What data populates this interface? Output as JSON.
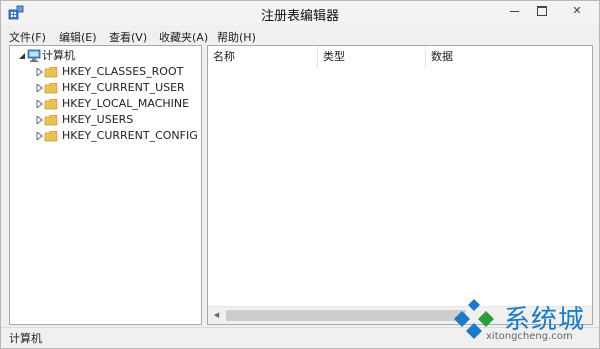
{
  "window": {
    "title": "注册表编辑器",
    "controls": {
      "close_glyph": "✕"
    }
  },
  "menu": {
    "items": [
      "文件(F)",
      "编辑(E)",
      "查看(V)",
      "收藏夹(A)",
      "帮助(H)"
    ]
  },
  "tree": {
    "root": {
      "label": "计算机",
      "icon": "computer-icon"
    },
    "items": [
      {
        "label": "HKEY_CLASSES_ROOT",
        "icon": "folder-icon"
      },
      {
        "label": "HKEY_CURRENT_USER",
        "icon": "folder-icon"
      },
      {
        "label": "HKEY_LOCAL_MACHINE",
        "icon": "folder-icon"
      },
      {
        "label": "HKEY_USERS",
        "icon": "folder-icon"
      },
      {
        "label": "HKEY_CURRENT_CONFIG",
        "icon": "folder-icon"
      }
    ]
  },
  "list": {
    "columns": [
      "名称",
      "类型",
      "数据"
    ]
  },
  "status": {
    "path": "计算机"
  },
  "watermark": {
    "brand": "系统城",
    "url": "xitongcheng.com"
  },
  "colors": {
    "folder": "#e8c15a",
    "watermark_blue": "#1d7bc6",
    "watermark_green": "#2a9d3a"
  }
}
